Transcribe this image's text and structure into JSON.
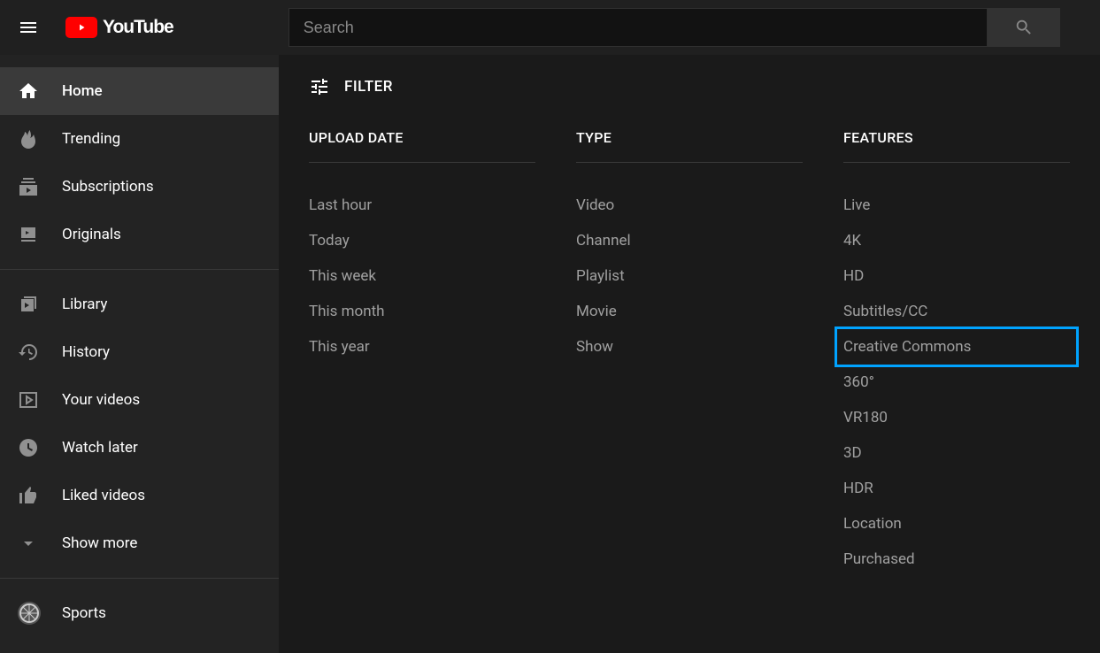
{
  "header": {
    "brand": "YouTube",
    "search_placeholder": "Search"
  },
  "sidebar": {
    "groups": [
      [
        {
          "label": "Home",
          "icon": "home",
          "active": true
        },
        {
          "label": "Trending",
          "icon": "trending"
        },
        {
          "label": "Subscriptions",
          "icon": "subscriptions"
        },
        {
          "label": "Originals",
          "icon": "originals"
        }
      ],
      [
        {
          "label": "Library",
          "icon": "library"
        },
        {
          "label": "History",
          "icon": "history"
        },
        {
          "label": "Your videos",
          "icon": "your-videos"
        },
        {
          "label": "Watch later",
          "icon": "watch-later"
        },
        {
          "label": "Liked videos",
          "icon": "liked"
        },
        {
          "label": "Show more",
          "icon": "chevron-down"
        }
      ],
      [
        {
          "label": "Sports",
          "icon": "sports"
        }
      ]
    ]
  },
  "filter": {
    "button_label": "FILTER",
    "columns": [
      {
        "heading": "UPLOAD DATE",
        "options": [
          "Last hour",
          "Today",
          "This week",
          "This month",
          "This year"
        ]
      },
      {
        "heading": "TYPE",
        "options": [
          "Video",
          "Channel",
          "Playlist",
          "Movie",
          "Show"
        ]
      },
      {
        "heading": "FEATURES",
        "options": [
          "Live",
          "4K",
          "HD",
          "Subtitles/CC",
          "Creative Commons",
          "360°",
          "VR180",
          "3D",
          "HDR",
          "Location",
          "Purchased"
        ],
        "highlight": "Creative Commons"
      }
    ]
  }
}
